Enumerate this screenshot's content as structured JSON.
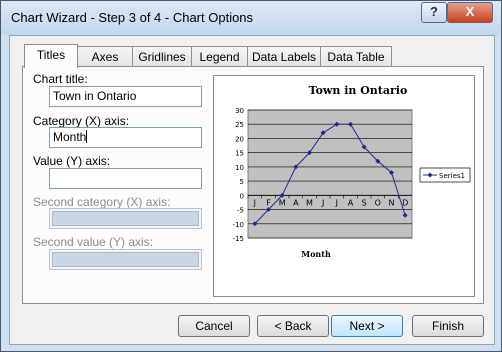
{
  "window": {
    "title": "Chart Wizard - Step 3 of 4 - Chart Options",
    "help_label": "?",
    "close_label": "X"
  },
  "tabs": [
    {
      "label": "Titles",
      "active": true
    },
    {
      "label": "Axes",
      "active": false
    },
    {
      "label": "Gridlines",
      "active": false
    },
    {
      "label": "Legend",
      "active": false
    },
    {
      "label": "Data Labels",
      "active": false
    },
    {
      "label": "Data Table",
      "active": false
    }
  ],
  "titles_tab": {
    "chart_title_label": "Chart title:",
    "chart_title_value": "Town in Ontario",
    "category_x_label": "Category (X) axis:",
    "category_x_value": "Month",
    "value_y_label": "Value (Y) axis:",
    "value_y_value": "",
    "second_category_x_label": "Second category (X) axis:",
    "second_value_y_label": "Second value (Y) axis:"
  },
  "chart_data": {
    "type": "line",
    "title": "Town in Ontario",
    "xlabel": "Month",
    "ylabel": "",
    "categories": [
      "J",
      "F",
      "M",
      "A",
      "M",
      "J",
      "J",
      "A",
      "S",
      "O",
      "N",
      "D"
    ],
    "series": [
      {
        "name": "Series1",
        "values": [
          -10,
          -5,
          0,
          10,
          15,
          22,
          25,
          25,
          17,
          12,
          8,
          -7
        ]
      }
    ],
    "ylim": [
      -15,
      30
    ],
    "yticks": [
      -15,
      -10,
      -5,
      0,
      5,
      10,
      15,
      20,
      25,
      30
    ],
    "grid": true,
    "legend_position": "right",
    "colors": {
      "series": "#1f2b8c",
      "plot_bg": "#c0c0c0"
    }
  },
  "buttons": {
    "cancel": "Cancel",
    "back": "< Back",
    "next": "Next >",
    "finish": "Finish"
  }
}
